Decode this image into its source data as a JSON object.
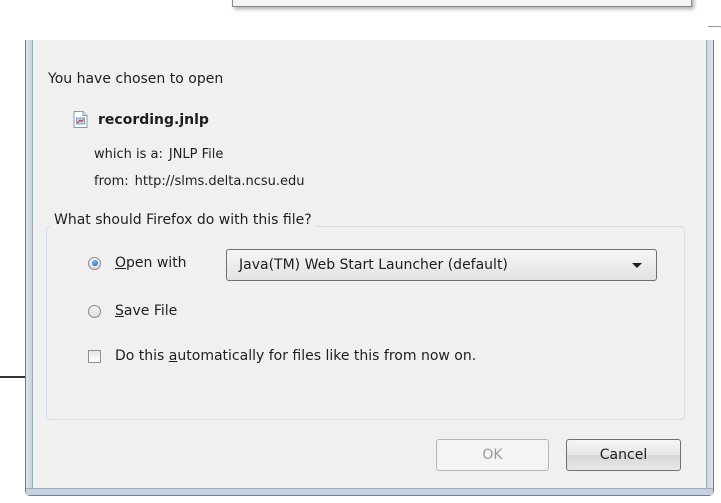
{
  "dialog": {
    "intro": "You have chosen to open",
    "file": {
      "name": "recording.jnlp",
      "icon": "jnlp-file-icon"
    },
    "which_is_label": "which is a:",
    "which_is_value": "JNLP File",
    "from_label": "from:",
    "from_value": "http://slms.delta.ncsu.edu",
    "group_title": "What should Firefox do with this file?",
    "open_with": {
      "label_prefix": "",
      "label_accel": "O",
      "label_rest": "pen with",
      "selected": true,
      "app": "Java(TM) Web Start Launcher (default)"
    },
    "save_file": {
      "label_accel": "S",
      "label_rest": "ave File",
      "selected": false
    },
    "auto_checkbox": {
      "label_prefix": "Do this ",
      "label_accel": "a",
      "label_rest": "utomatically for files like this from now on.",
      "checked": false
    },
    "buttons": {
      "ok": "OK",
      "cancel": "Cancel"
    }
  }
}
